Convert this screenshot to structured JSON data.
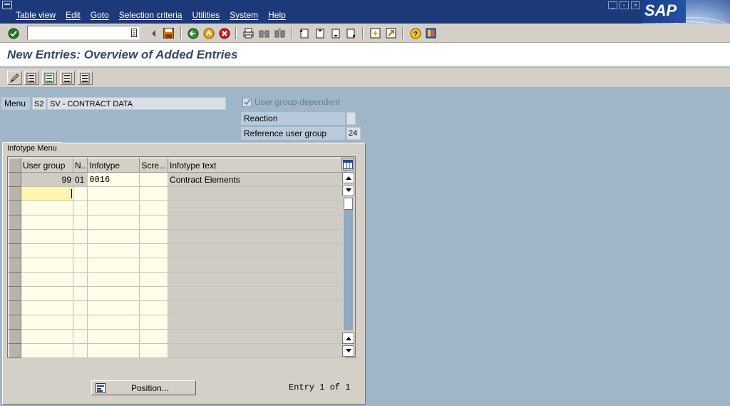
{
  "menubar": {
    "items": [
      "Table view",
      "Edit",
      "Goto",
      "Selection criteria",
      "Utilities",
      "System",
      "Help"
    ],
    "logo": "SAP"
  },
  "toolbar": {
    "command_value": ""
  },
  "screen": {
    "title": "New Entries: Overview of Added Entries"
  },
  "header": {
    "menu_label": "Menu",
    "menu_code": "S2",
    "menu_text": "SV - CONTRACT DATA",
    "user_group_dependent_label": "User group-dependent",
    "user_group_dependent_checked": true,
    "reaction_label": "Reaction",
    "reaction_value": "",
    "ref_user_group_label": "Reference user group",
    "ref_user_group_value": "24"
  },
  "tab": {
    "label": "Infotype Menu"
  },
  "table": {
    "columns": [
      "User group",
      "N..",
      "Infotype",
      "Scre...",
      "Infotype text"
    ],
    "rows": [
      [
        "99",
        "01",
        "0016",
        "",
        "Contract Elements"
      ]
    ]
  },
  "footer": {
    "position_button": "Position...",
    "entry_info": "Entry 1 of 1"
  },
  "colors": {
    "menubar": "#1c3a7a",
    "background": "#9fb6c9",
    "title_text": "#33466b"
  }
}
